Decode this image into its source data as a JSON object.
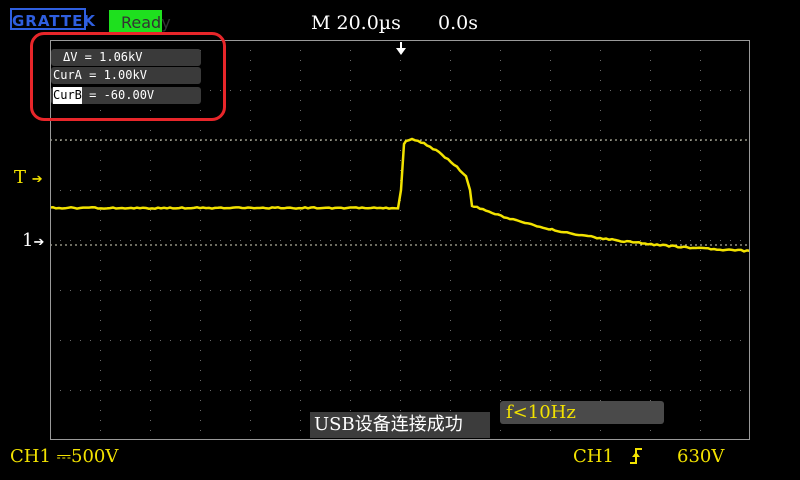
{
  "header": {
    "logo_text": "GRATTEK",
    "status": "Ready",
    "timebase": "M 20.0µs",
    "trigger_offset": "0.0s"
  },
  "cursors": {
    "delta_label": "ΔV",
    "delta_value": " = 1.06kV",
    "cur_a_label": "CurA",
    "cur_a_value": " = 1.00kV",
    "cur_b_label": "CurB",
    "cur_b_value": " = -60.00V"
  },
  "markers": {
    "trigger_label": "T",
    "channel_label": "1"
  },
  "footer": {
    "ch1_scale": "CH1 ⎓500V",
    "usb_message": "USB设备连接成功",
    "frequency": "f<10Hz",
    "trigger_channel": "CH1",
    "trigger_level": "630V"
  },
  "colors": {
    "trace": "#f2e200",
    "status_bg": "#1ee01e",
    "highlight": "#e8262a"
  },
  "icons": {
    "trigger_edge": "rising-edge-icon",
    "trigger_position": "down-arrow-icon"
  }
}
